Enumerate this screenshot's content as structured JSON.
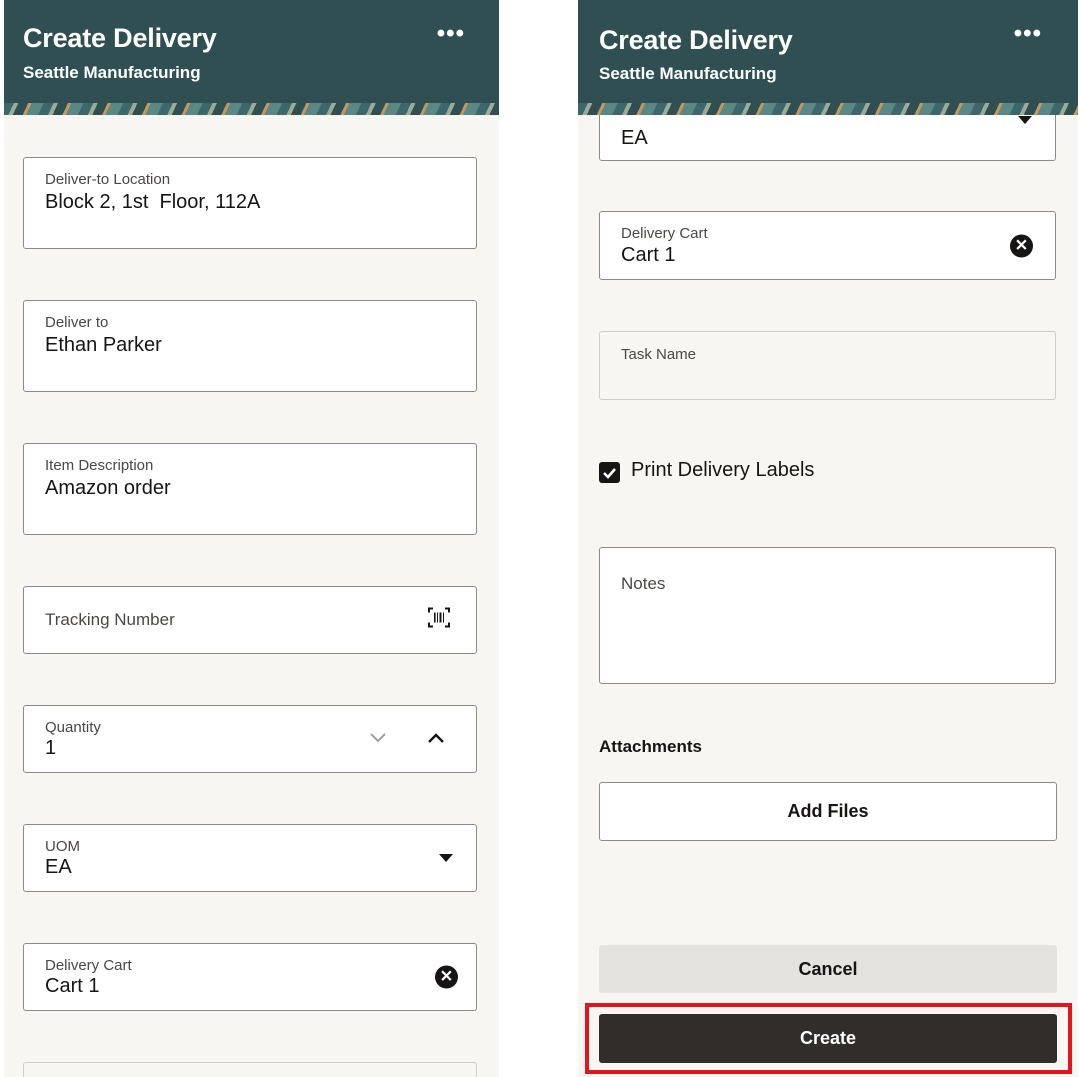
{
  "header": {
    "title": "Create Delivery",
    "subtitle": "Seattle Manufacturing",
    "more_label": "•••"
  },
  "form": {
    "deliver_to_location": {
      "label": "Deliver-to Location",
      "value": "Block 2, 1st  Floor, 112A"
    },
    "deliver_to": {
      "label": "Deliver to",
      "value": "Ethan Parker"
    },
    "item_description": {
      "label": "Item Description",
      "value": "Amazon order"
    },
    "tracking_number": {
      "label": "Tracking Number"
    },
    "quantity": {
      "label": "Quantity",
      "value": "1"
    },
    "uom": {
      "label": "UOM",
      "value": "EA"
    },
    "delivery_cart": {
      "label": "Delivery Cart",
      "value": "Cart 1",
      "clear_glyph": "✕"
    },
    "task_name": {
      "label": "Task Name"
    },
    "print_delivery_labels": {
      "label": "Print Delivery Labels",
      "checked": true
    },
    "notes": {
      "label": "Notes"
    }
  },
  "attachments": {
    "heading": "Attachments",
    "add_files_label": "Add Files"
  },
  "actions": {
    "cancel_label": "Cancel",
    "create_label": "Create"
  },
  "colors": {
    "header_bg": "#2f4f52",
    "page_bg": "#f8f6f3",
    "create_bg": "#312d2a",
    "highlight": "#e3141f"
  },
  "icons": [
    "more-icon",
    "barcode-scan-icon",
    "chevron-down-icon",
    "chevron-up-icon",
    "caret-down-icon",
    "clear-icon",
    "checkmark-icon"
  ]
}
